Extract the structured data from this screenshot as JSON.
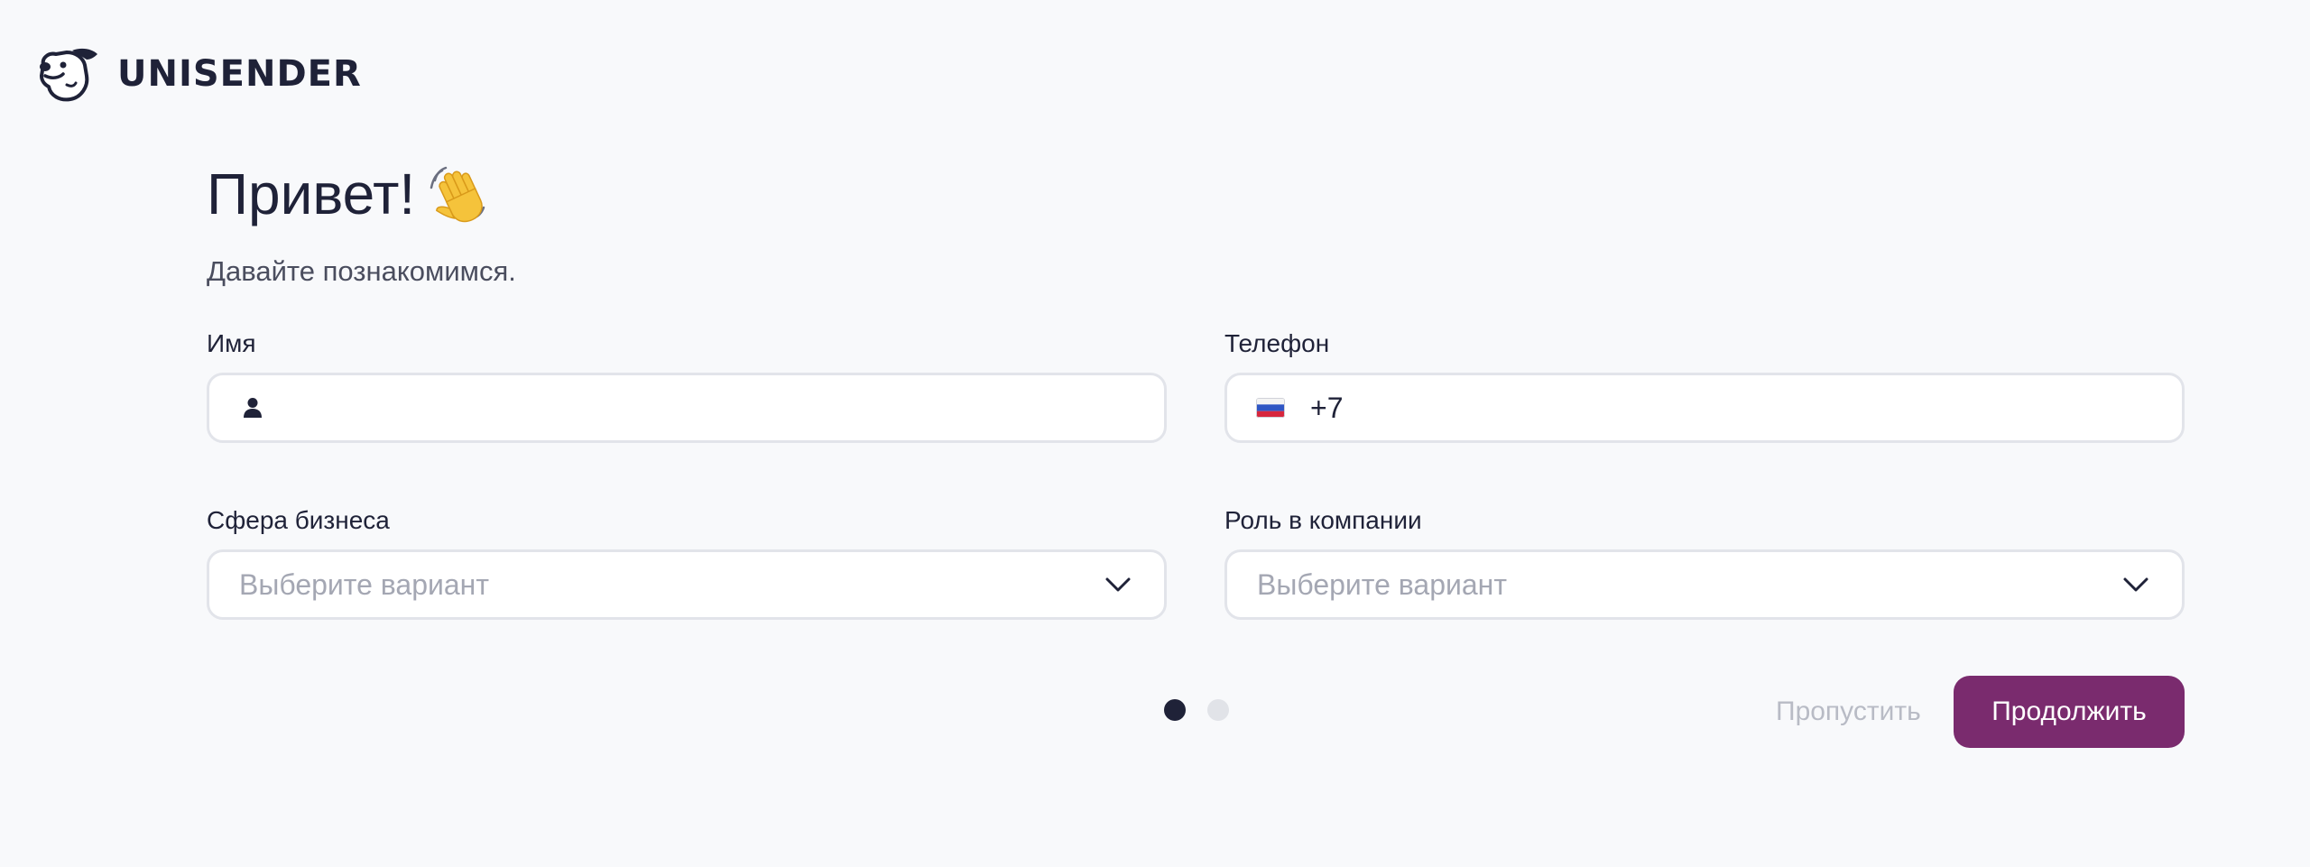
{
  "brand": {
    "name": "UNISENDER",
    "logo_icon": "dog-mascot-icon"
  },
  "header": {
    "title": "Привет!",
    "title_icon": "waving-hand-icon",
    "subtitle": "Давайте познакомимся."
  },
  "form": {
    "name": {
      "label": "Имя",
      "value": "",
      "icon": "person-icon"
    },
    "phone": {
      "label": "Телефон",
      "country_icon": "russia-flag-icon",
      "code": "+7",
      "value": ""
    },
    "business": {
      "label": "Сфера бизнеса",
      "placeholder": "Выберите вариант",
      "icon": "chevron-down-icon"
    },
    "role": {
      "label": "Роль в компании",
      "placeholder": "Выберите вариант",
      "icon": "chevron-down-icon"
    }
  },
  "footer": {
    "steps_total": 2,
    "current_step": 1,
    "skip_label": "Пропустить",
    "continue_label": "Продолжить"
  },
  "colors": {
    "background": "#f8f9fb",
    "primary": "#7a2b6e",
    "text": "#1f2238",
    "border": "#e2e4ea",
    "muted": "#a4a7b3"
  }
}
